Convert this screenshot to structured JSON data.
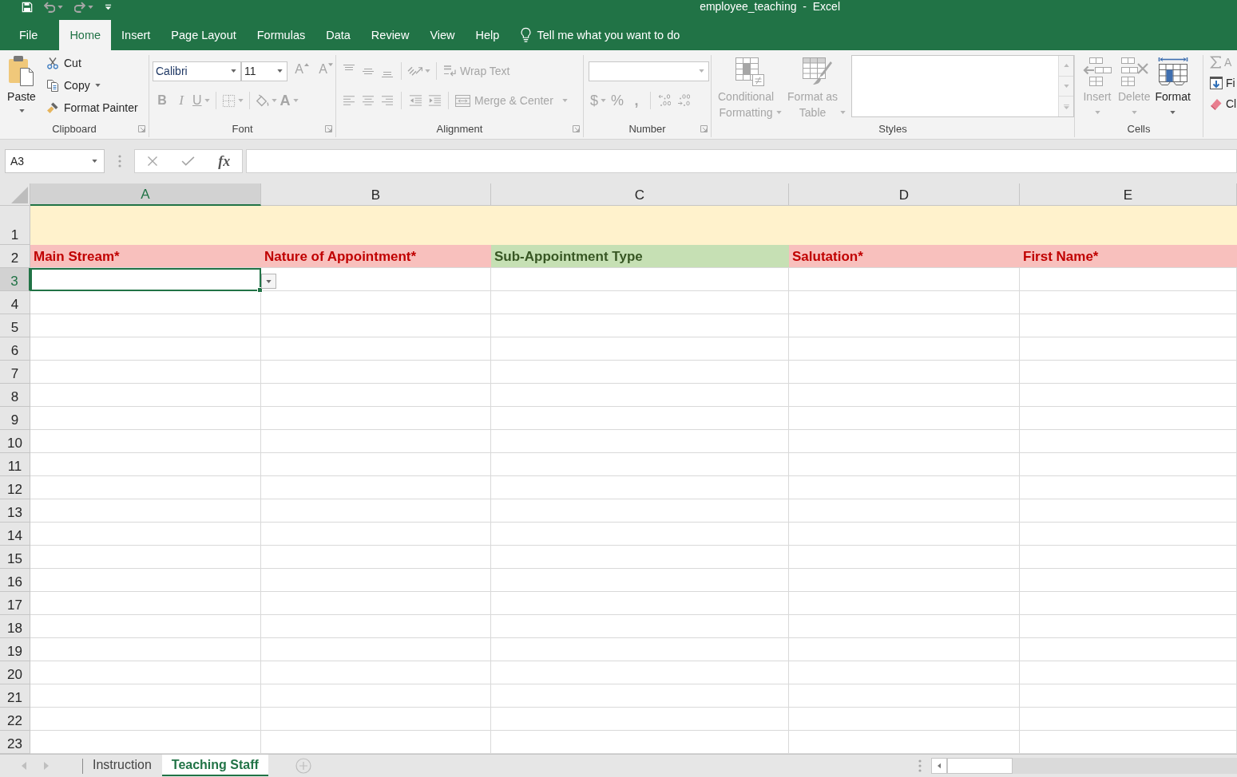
{
  "title_bar": {
    "title": "employee_teaching  -  Excel",
    "quick_access": [
      {
        "kind": "save",
        "disabled": false,
        "dropdown": false
      },
      {
        "kind": "undo",
        "disabled": true,
        "dropdown": true
      },
      {
        "kind": "redo",
        "disabled": true,
        "dropdown": true
      },
      {
        "kind": "customize",
        "disabled": false,
        "dropdown": false
      }
    ]
  },
  "menu": {
    "tabs": [
      {
        "label": "File",
        "selected": false
      },
      {
        "label": "Home",
        "selected": true
      },
      {
        "label": "Insert",
        "selected": false
      },
      {
        "label": "Page Layout",
        "selected": false
      },
      {
        "label": "Formulas",
        "selected": false
      },
      {
        "label": "Data",
        "selected": false
      },
      {
        "label": "Review",
        "selected": false
      },
      {
        "label": "View",
        "selected": false
      },
      {
        "label": "Help",
        "selected": false
      }
    ],
    "tell_me": {
      "placeholder": "Tell me what you want to do"
    }
  },
  "ribbon": {
    "clipboard": {
      "label": "Clipboard",
      "launcher": true,
      "paste": {
        "label": "Paste",
        "disabled": false,
        "dropdown": true
      },
      "commands": [
        {
          "kind": "cut",
          "label": "Cut",
          "disabled": false,
          "dropdown": false
        },
        {
          "kind": "copy",
          "label": "Copy",
          "disabled": false,
          "dropdown": true
        },
        {
          "kind": "format_painter",
          "label": "Format Painter",
          "disabled": false,
          "dropdown": false
        }
      ]
    },
    "font": {
      "label": "Font",
      "launcher": true,
      "font_name": {
        "value": "Calibri",
        "disabled": false
      },
      "font_size": {
        "value": "11",
        "disabled": false
      },
      "size_buttons": [
        {
          "kind": "grow",
          "glyph": "A",
          "disabled": true
        },
        {
          "kind": "shrink",
          "glyph": "A",
          "disabled": true
        }
      ],
      "format_buttons": [
        {
          "kind": "bold",
          "glyph": "B",
          "disabled": true,
          "dropdown": false
        },
        {
          "kind": "italic",
          "glyph": "I",
          "disabled": true,
          "dropdown": false
        },
        {
          "kind": "underline",
          "glyph": "U",
          "disabled": true,
          "dropdown": true
        },
        {
          "kind": "borders",
          "disabled": true,
          "dropdown": true
        },
        {
          "kind": "fill_color",
          "disabled": true,
          "dropdown": true
        },
        {
          "kind": "font_color",
          "glyph": "A",
          "disabled": true,
          "dropdown": true
        }
      ]
    },
    "alignment": {
      "label": "Alignment",
      "launcher": true,
      "top_row": [
        {
          "kind": "align_top",
          "disabled": true,
          "dropdown": false
        },
        {
          "kind": "align_middle",
          "disabled": true,
          "dropdown": false
        },
        {
          "kind": "align_bottom",
          "disabled": true,
          "dropdown": false
        },
        {
          "kind": "orientation",
          "disabled": true,
          "dropdown": true
        }
      ],
      "wrap_text": {
        "label": "Wrap Text",
        "disabled": true
      },
      "bottom_row": [
        {
          "kind": "align_left",
          "disabled": true,
          "dropdown": false
        },
        {
          "kind": "align_center",
          "disabled": true,
          "dropdown": false
        },
        {
          "kind": "align_right",
          "disabled": true,
          "dropdown": false
        },
        {
          "kind": "decrease_indent",
          "disabled": true,
          "dropdown": false
        },
        {
          "kind": "increase_indent",
          "disabled": true,
          "dropdown": false
        }
      ],
      "merge": {
        "label": "Merge & Center",
        "disabled": true,
        "dropdown": true
      }
    },
    "number": {
      "label": "Number",
      "launcher": true,
      "format_box": {
        "disabled": true
      },
      "buttons": [
        {
          "kind": "currency",
          "glyph": "$",
          "disabled": true,
          "dropdown": true
        },
        {
          "kind": "percent",
          "glyph": "%",
          "disabled": true,
          "dropdown": false
        },
        {
          "kind": "comma",
          "glyph": ",",
          "disabled": true,
          "dropdown": false
        },
        {
          "kind": "increase_decimal",
          "disabled": true,
          "dropdown": false
        },
        {
          "kind": "decrease_decimal",
          "disabled": true,
          "dropdown": false
        }
      ]
    },
    "styles": {
      "label": "Styles",
      "buttons": [
        {
          "kind": "conditional_formatting",
          "lines": [
            "Conditional",
            "Formatting"
          ],
          "disabled": true,
          "dropdown": true
        },
        {
          "kind": "format_as_table",
          "lines": [
            "Format as",
            "Table"
          ],
          "disabled": true,
          "dropdown": true
        }
      ]
    },
    "cells": {
      "label": "Cells",
      "buttons": [
        {
          "kind": "insert",
          "label": "Insert",
          "disabled": true,
          "dropdown": true
        },
        {
          "kind": "delete",
          "label": "Delete",
          "disabled": true,
          "dropdown": true
        },
        {
          "kind": "format",
          "label": "Format",
          "disabled": false,
          "dropdown": true
        }
      ]
    },
    "editing": {
      "buttons": [
        {
          "kind": "autosum",
          "label": "A",
          "disabled": true
        },
        {
          "kind": "fill",
          "label": "Fi",
          "disabled": false
        },
        {
          "kind": "clear",
          "label": "Cl",
          "disabled": false
        }
      ]
    }
  },
  "formula_bar": {
    "name_box": "A3",
    "cancel": {
      "disabled": true
    },
    "enter": {
      "disabled": true
    },
    "insert_function": {
      "label": "fx",
      "disabled": false
    }
  },
  "sheet": {
    "columns": [
      {
        "label": "A",
        "selected": true
      },
      {
        "label": "B",
        "selected": false
      },
      {
        "label": "C",
        "selected": false
      },
      {
        "label": "D",
        "selected": false
      },
      {
        "label": "E",
        "selected": false
      }
    ],
    "rows": [
      {
        "label": "1",
        "selected": false,
        "kind": "banner"
      },
      {
        "label": "2",
        "selected": false,
        "kind": "header",
        "cells": [
          {
            "text": "Main Stream*",
            "kind": "required"
          },
          {
            "text": "Nature of Appointment*",
            "kind": "required"
          },
          {
            "text": "Sub-Appointment Type",
            "kind": "optional"
          },
          {
            "text": "Salutation*",
            "kind": "required"
          },
          {
            "text": "First Name*",
            "kind": "required"
          }
        ]
      },
      {
        "label": "3",
        "selected": true,
        "kind": "data"
      },
      {
        "label": "4",
        "selected": false,
        "kind": "data"
      },
      {
        "label": "5",
        "selected": false,
        "kind": "data"
      },
      {
        "label": "6",
        "selected": false,
        "kind": "data"
      },
      {
        "label": "7",
        "selected": false,
        "kind": "data"
      },
      {
        "label": "8",
        "selected": false,
        "kind": "data"
      },
      {
        "label": "9",
        "selected": false,
        "kind": "data"
      },
      {
        "label": "10",
        "selected": false,
        "kind": "data"
      },
      {
        "label": "11",
        "selected": false,
        "kind": "data"
      },
      {
        "label": "12",
        "selected": false,
        "kind": "data"
      },
      {
        "label": "13",
        "selected": false,
        "kind": "data"
      },
      {
        "label": "14",
        "selected": false,
        "kind": "data"
      },
      {
        "label": "15",
        "selected": false,
        "kind": "data"
      },
      {
        "label": "16",
        "selected": false,
        "kind": "data"
      },
      {
        "label": "17",
        "selected": false,
        "kind": "data"
      },
      {
        "label": "18",
        "selected": false,
        "kind": "data"
      },
      {
        "label": "19",
        "selected": false,
        "kind": "data"
      },
      {
        "label": "20",
        "selected": false,
        "kind": "data"
      },
      {
        "label": "21",
        "selected": false,
        "kind": "data"
      },
      {
        "label": "22",
        "selected": false,
        "kind": "data"
      },
      {
        "label": "23",
        "selected": false,
        "kind": "data"
      }
    ],
    "cell_dropdown": true
  },
  "sheet_tabs": {
    "nav_disabled": true,
    "tabs": [
      {
        "label": "Instruction",
        "selected": false
      },
      {
        "label": "Teaching Staff",
        "selected": true
      }
    ]
  }
}
